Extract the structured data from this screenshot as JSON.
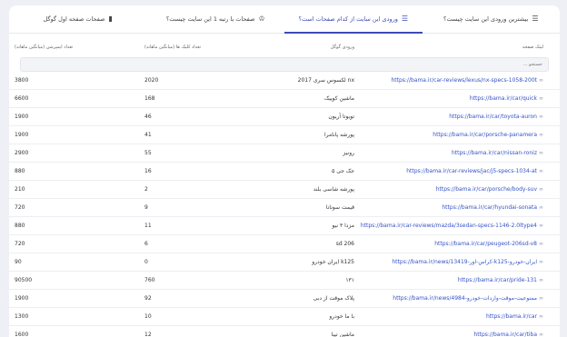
{
  "tabs": [
    {
      "label": "بیشترین ورودی این سایت چیست؟",
      "icon": "list-icon",
      "active": false
    },
    {
      "label": "ورودی این سایت از کدام صفحات است؟",
      "icon": "list-icon",
      "active": true
    },
    {
      "label": "صفحات با رتبه 1 این سایت چیست؟",
      "icon": "award-icon",
      "active": false
    },
    {
      "label": "صفحات صفحه اول گوگل",
      "icon": "bar-chart-icon",
      "active": false
    }
  ],
  "table": {
    "headers": {
      "url": "لینک صفحه",
      "keyword": "ورودی گوگل",
      "clicks": "تعداد کلیک ها (میانگین ماهانه)",
      "impressions": "تعداد ایمپرشن (میانگین ماهانه)"
    },
    "search_placeholder": "جستجو ...",
    "rows": [
      {
        "url": "https://bama.ir/car-reviews/lexus/nx-specs-1058-200t",
        "keyword": "nx لکسوس سری 2017",
        "clicks": "2020",
        "impressions": "3800"
      },
      {
        "url": "https://bama.ir/car/quick",
        "keyword": "ماشین کوییک",
        "clicks": "168",
        "impressions": "6600"
      },
      {
        "url": "https://bama.ir/car/toyota-auron",
        "keyword": "تویوتا آریون",
        "clicks": "46",
        "impressions": "1900"
      },
      {
        "url": "https://bama.ir/car/porsche-panamera",
        "keyword": "پورشه پانامرا",
        "clicks": "41",
        "impressions": "1900"
      },
      {
        "url": "https://bama.ir/car/nissan-roniz",
        "keyword": "رونیز",
        "clicks": "55",
        "impressions": "2900"
      },
      {
        "url": "https://bama.ir/car-reviews/jac/j5-specs-1034-at",
        "keyword": "جک جی ۵",
        "clicks": "16",
        "impressions": "880"
      },
      {
        "url": "https://bama.ir/car/porsche/body-suv",
        "keyword": "پورشه شاسی بلند",
        "clicks": "2",
        "impressions": "210"
      },
      {
        "url": "https://bama.ir/car/hyundai-sonata",
        "keyword": "قیمت سوناتا",
        "clicks": "9",
        "impressions": "720"
      },
      {
        "url": "https://bama.ir/car-reviews/mazda/3sedan-specs-1146-2.0ltype4",
        "keyword": "مزدا ۳ نیو",
        "clicks": "11",
        "impressions": "880"
      },
      {
        "url": "https://bama.ir/car/peugeot-206sd-v8",
        "keyword": "206 sd",
        "clicks": "6",
        "impressions": "720"
      },
      {
        "url": "https://bama.ir/news/13419-کراس-اور-k125-ایران-خودرو",
        "keyword": "k125 ایران خودرو",
        "clicks": "0",
        "impressions": "90"
      },
      {
        "url": "https://bama.ir/car/pride-131",
        "keyword": "۱۳۱",
        "clicks": "760",
        "impressions": "90500"
      },
      {
        "url": "https://bama.ir/news/4984-ممنوعیت-موقت-واردات-خودرو",
        "keyword": "پلاک موقت از دبی",
        "clicks": "92",
        "impressions": "1900"
      },
      {
        "url": "https://bama.ir/car",
        "keyword": "با ما خودرو",
        "clicks": "10",
        "impressions": "1300"
      },
      {
        "url": "https://bama.ir/car/tiba",
        "keyword": "ماشین تیبا",
        "clicks": "12",
        "impressions": "1600"
      }
    ]
  },
  "colors": {
    "accent": "#3e4bb8",
    "link": "#3553c8",
    "background": "#eef0f5"
  }
}
